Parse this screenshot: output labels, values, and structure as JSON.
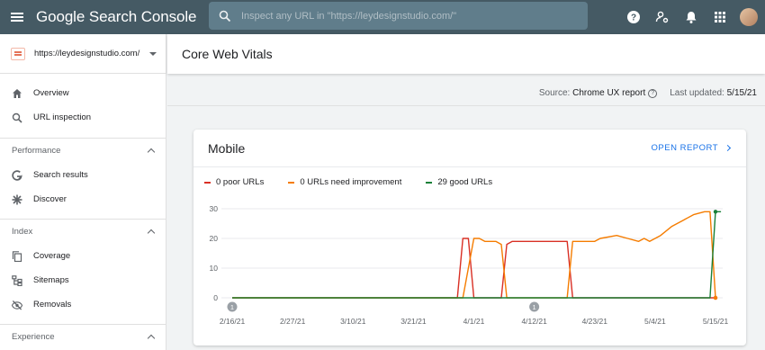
{
  "app": {
    "title": "Google Search Console"
  },
  "search": {
    "placeholder": "Inspect any URL in \"https://leydesignstudio.com/\""
  },
  "topbar": {
    "icons": [
      "help-icon",
      "account-settings-icon",
      "notifications-icon",
      "apps-icon",
      "avatar"
    ]
  },
  "sidebar": {
    "property": "https://leydesignstudio.com/",
    "top_items": [
      {
        "label": "Overview",
        "icon": "home-icon"
      },
      {
        "label": "URL inspection",
        "icon": "search-icon"
      }
    ],
    "sections": [
      {
        "title": "Performance",
        "items": [
          {
            "label": "Search results",
            "icon": "google-g-icon"
          },
          {
            "label": "Discover",
            "icon": "asterisk-icon"
          }
        ]
      },
      {
        "title": "Index",
        "items": [
          {
            "label": "Coverage",
            "icon": "copy-icon"
          },
          {
            "label": "Sitemaps",
            "icon": "sitemap-icon"
          },
          {
            "label": "Removals",
            "icon": "visibility-off-icon"
          }
        ]
      },
      {
        "title": "Experience",
        "items": []
      }
    ]
  },
  "page": {
    "title": "Core Web Vitals",
    "source_label": "Source:",
    "source_value": "Chrome UX report",
    "updated_label": "Last updated:",
    "updated_value": "5/15/21"
  },
  "card": {
    "title": "Mobile",
    "action": "OPEN REPORT",
    "legend": [
      {
        "label": "0 poor URLs",
        "color": "#d93025"
      },
      {
        "label": "0 URLs need improvement",
        "color": "#f57c00"
      },
      {
        "label": "29 good URLs",
        "color": "#188038"
      }
    ]
  },
  "chart_data": {
    "type": "line",
    "x_ticks": [
      "2/16/21",
      "2/27/21",
      "3/10/21",
      "3/21/21",
      "4/1/21",
      "4/12/21",
      "4/23/21",
      "5/4/21",
      "5/15/21"
    ],
    "y_ticks": [
      0,
      10,
      20,
      30
    ],
    "ylim": [
      0,
      30
    ],
    "annotations": [
      {
        "x": "2/16/21",
        "label": "1"
      },
      {
        "x": "4/12/21",
        "label": "1"
      }
    ],
    "series": [
      {
        "name": "Poor",
        "color": "#d93025",
        "points": [
          [
            "2/16/21",
            0
          ],
          [
            "3/29/21",
            0
          ],
          [
            "3/30/21",
            20
          ],
          [
            "3/31/21",
            20
          ],
          [
            "4/1/21",
            0
          ],
          [
            "4/6/21",
            0
          ],
          [
            "4/7/21",
            18
          ],
          [
            "4/8/21",
            19
          ],
          [
            "4/18/21",
            19
          ],
          [
            "4/19/21",
            0
          ],
          [
            "5/15/21",
            0
          ]
        ]
      },
      {
        "name": "Need improvement",
        "color": "#f57c00",
        "points": [
          [
            "2/16/21",
            0
          ],
          [
            "3/30/21",
            0
          ],
          [
            "4/1/21",
            20
          ],
          [
            "4/2/21",
            20
          ],
          [
            "4/3/21",
            19
          ],
          [
            "4/5/21",
            19
          ],
          [
            "4/6/21",
            18
          ],
          [
            "4/7/21",
            0
          ],
          [
            "4/18/21",
            0
          ],
          [
            "4/19/21",
            19
          ],
          [
            "4/23/21",
            19
          ],
          [
            "4/24/21",
            20
          ],
          [
            "4/27/21",
            21
          ],
          [
            "4/29/21",
            20
          ],
          [
            "5/1/21",
            19
          ],
          [
            "5/2/21",
            20
          ],
          [
            "5/3/21",
            19
          ],
          [
            "5/5/21",
            21
          ],
          [
            "5/7/21",
            24
          ],
          [
            "5/9/21",
            26
          ],
          [
            "5/11/21",
            28
          ],
          [
            "5/13/21",
            29
          ],
          [
            "5/14/21",
            29
          ],
          [
            "5/15/21",
            0
          ]
        ]
      },
      {
        "name": "Good",
        "color": "#188038",
        "points": [
          [
            "2/16/21",
            0
          ],
          [
            "5/14/21",
            0
          ],
          [
            "5/15/21",
            29
          ],
          [
            "5/16/21",
            29
          ]
        ]
      }
    ]
  }
}
